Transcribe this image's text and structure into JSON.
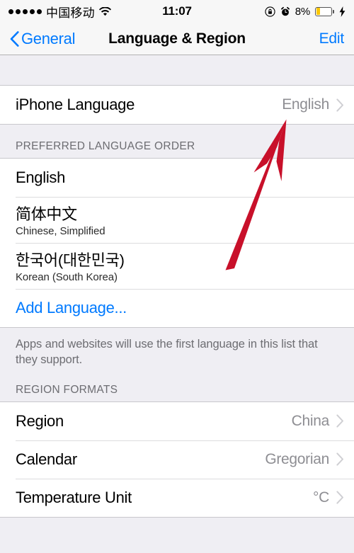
{
  "status_bar": {
    "signal_dots": 5,
    "carrier": "中国移动",
    "wifi_icon": "wifi-icon",
    "time": "11:07",
    "rotation_lock_icon": "rotation-lock-icon",
    "alarm_icon": "alarm-clock-icon",
    "battery_percent": "8%",
    "battery_fill_color": "#FBC700",
    "charging_icon": "lightning-bolt-icon"
  },
  "nav_bar": {
    "back_label": "General",
    "back_icon": "chevron-left-icon",
    "title": "Language & Region",
    "edit_label": "Edit"
  },
  "sections": {
    "language": {
      "rows": [
        {
          "title": "iPhone Language",
          "value": "English",
          "chevron": "chevron-right-icon"
        }
      ]
    },
    "preferred_order": {
      "header": "PREFERRED LANGUAGE ORDER",
      "rows": [
        {
          "title": "English",
          "sub": ""
        },
        {
          "title": "简体中文",
          "sub": "Chinese, Simplified"
        },
        {
          "title": "한국어(대한민국)",
          "sub": "Korean (South Korea)"
        },
        {
          "title": "Add Language...",
          "sub": ""
        }
      ],
      "footer": "Apps and websites will use the first language in this list that they support."
    },
    "region_formats": {
      "header": "REGION FORMATS",
      "rows": [
        {
          "title": "Region",
          "value": "China",
          "chevron": "chevron-right-icon"
        },
        {
          "title": "Calendar",
          "value": "Gregorian",
          "chevron": "chevron-right-icon"
        },
        {
          "title": "Temperature Unit",
          "value": "°C",
          "chevron": "chevron-right-icon"
        }
      ]
    }
  },
  "annotation": {
    "arrow_color": "#C8102A",
    "arrow_points_to": "English"
  },
  "colors": {
    "tint_blue": "#007AFF",
    "background_gray": "#EFEEF3",
    "value_gray": "#8E8E93"
  }
}
